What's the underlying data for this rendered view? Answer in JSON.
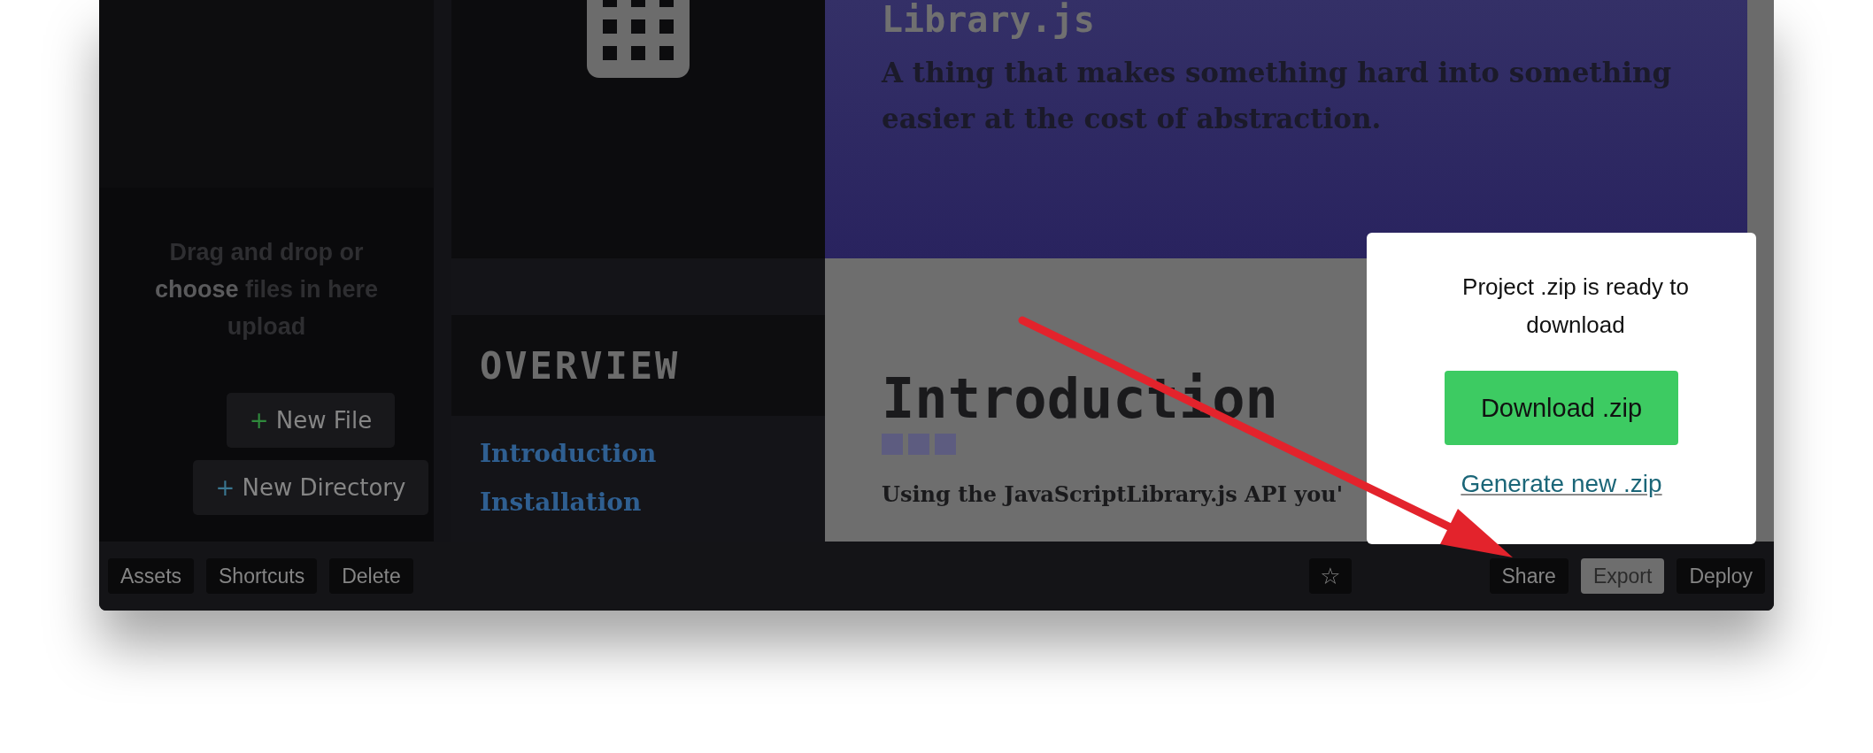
{
  "sidebar": {
    "drop_zone": {
      "lines": [
        "Drag and drop or",
        "**choose** files in here",
        "upload"
      ]
    },
    "buttons": [
      {
        "icon": "+",
        "label": "New File",
        "color": "#2f8a3c"
      },
      {
        "icon": "+",
        "label": "New Directory",
        "color": "#3a7690"
      }
    ]
  },
  "navigation": {
    "heading": "OVERVIEW",
    "links": [
      "Introduction",
      "Installation"
    ]
  },
  "preview": {
    "title": "Library.js",
    "tagline": "A thing that makes something hard into something easier at the cost of abstraction.",
    "section_heading": "Introduction",
    "paragraph": "Using the JavaScriptLibrary.js API you'"
  },
  "export_popup": {
    "message": "Project .zip is ready to download",
    "primary_button": "Download .zip",
    "link": "Generate new .zip"
  },
  "toolbar": {
    "left": [
      {
        "label": "Assets"
      },
      {
        "label": "Shortcuts"
      },
      {
        "label": "Delete"
      }
    ],
    "star": "☆",
    "right": [
      {
        "label": "Share",
        "selected": false
      },
      {
        "label": "Export",
        "selected": true
      },
      {
        "label": "Deploy",
        "selected": false
      }
    ]
  }
}
